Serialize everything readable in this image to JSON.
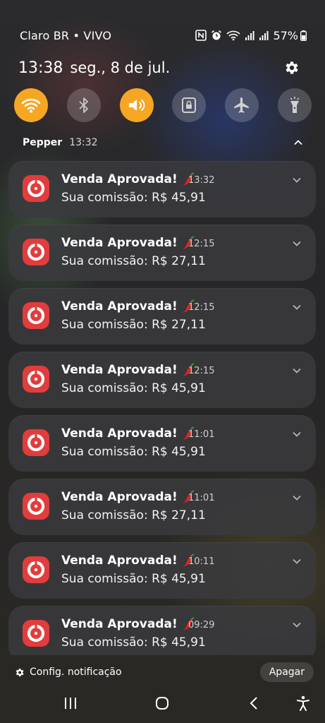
{
  "status_bar": {
    "carrier": "Claro BR • VIVO",
    "battery": "57%"
  },
  "header": {
    "time": "13:38",
    "date": "seg., 8 de jul."
  },
  "quick_settings": [
    {
      "name": "wifi",
      "active": true
    },
    {
      "name": "bluetooth",
      "active": false
    },
    {
      "name": "sound",
      "active": true
    },
    {
      "name": "rotation-lock",
      "active": false
    },
    {
      "name": "airplane",
      "active": false
    },
    {
      "name": "flashlight",
      "active": false
    }
  ],
  "notification_group": {
    "app_name": "Pepper",
    "time": "13:32"
  },
  "notifications": [
    {
      "title": "Venda Aprovada!",
      "time": "13:32",
      "body": "Sua comissão: R$ 45,91"
    },
    {
      "title": "Venda Aprovada!",
      "time": "12:15",
      "body": "Sua comissão: R$ 27,11"
    },
    {
      "title": "Venda Aprovada!",
      "time": "12:15",
      "body": "Sua comissão: R$ 27,11"
    },
    {
      "title": "Venda Aprovada!",
      "time": "12:15",
      "body": "Sua comissão: R$ 45,91"
    },
    {
      "title": "Venda Aprovada!",
      "time": "11:01",
      "body": "Sua comissão: R$ 45,91"
    },
    {
      "title": "Venda Aprovada!",
      "time": "11:01",
      "body": "Sua comissão: R$ 27,11"
    },
    {
      "title": "Venda Aprovada!",
      "time": "10:11",
      "body": "Sua comissão: R$ 45,91"
    },
    {
      "title": "Venda Aprovada!",
      "time": "09:29",
      "body": "Sua comissão: R$ 45,91"
    }
  ],
  "footer": {
    "settings_label": "Config. notificação",
    "clear_label": "Apagar"
  },
  "colors": {
    "accent": "#f5a623",
    "app_icon": "#e23c3c"
  }
}
